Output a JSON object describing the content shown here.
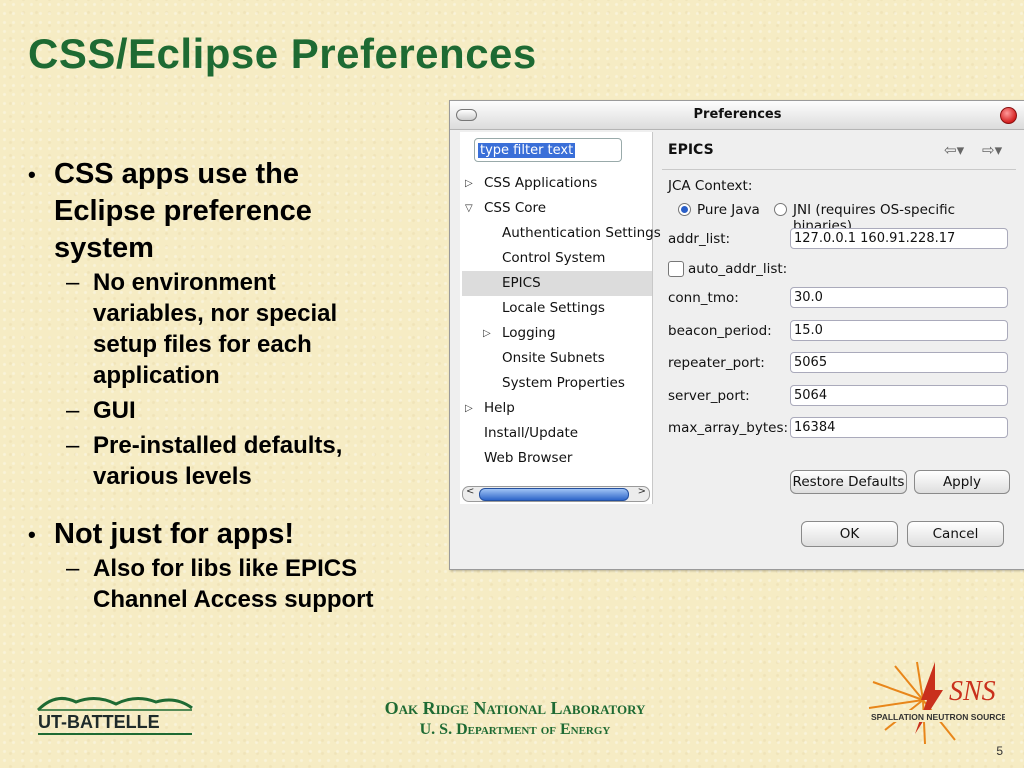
{
  "slide": {
    "title": "CSS/Eclipse Preferences",
    "bullets": [
      {
        "text_lines": [
          "CSS apps use the",
          "Eclipse preference",
          "system"
        ],
        "sub": [
          {
            "lines": [
              "No environment",
              "variables, nor special",
              "setup files for each",
              "application"
            ]
          },
          {
            "lines": [
              "GUI"
            ]
          },
          {
            "lines": [
              "Pre-installed defaults,",
              "various levels"
            ]
          }
        ]
      },
      {
        "text_lines": [
          "Not just for apps!"
        ],
        "sub": [
          {
            "lines": [
              "Also for libs like EPICS",
              "Channel Access support"
            ]
          }
        ]
      }
    ],
    "page_number": "5"
  },
  "footer": {
    "line1": "Oak Ridge National Laboratory",
    "line2": "U. S. Department of Energy",
    "left_logo_text": "UT-BATTELLE",
    "right_logo_text": "SNS",
    "right_logo_subtext": "SPALLATION NEUTRON SOURCE"
  },
  "dialog": {
    "title": "Preferences",
    "filter_placeholder": "type filter text",
    "tree": [
      {
        "label": "CSS Applications",
        "level": 0,
        "arrow": "right"
      },
      {
        "label": "CSS Core",
        "level": 0,
        "arrow": "down"
      },
      {
        "label": "Authentication Settings",
        "level": 1
      },
      {
        "label": "Control System",
        "level": 1
      },
      {
        "label": "EPICS",
        "level": 1,
        "selected": true
      },
      {
        "label": "Locale Settings",
        "level": 1
      },
      {
        "label": "Logging",
        "level": 1,
        "arrow": "right"
      },
      {
        "label": "Onsite Subnets",
        "level": 1
      },
      {
        "label": "System Properties",
        "level": 1
      },
      {
        "label": "Help",
        "level": 0,
        "arrow": "right"
      },
      {
        "label": "Install/Update",
        "level": 0
      },
      {
        "label": "Web Browser",
        "level": 0
      }
    ],
    "page_title": "EPICS",
    "jca_context_label": "JCA Context:",
    "radio_pure_java": "Pure Java",
    "radio_jni": "JNI (requires OS-specific binaries)",
    "radio_selected": "pure_java",
    "addr_list_label": "addr_list:",
    "addr_list_value": "127.0.0.1 160.91.228.17",
    "auto_addr_list_label": "auto_addr_list:",
    "auto_addr_list_checked": false,
    "conn_tmo_label": "conn_tmo:",
    "conn_tmo_value": "30.0",
    "beacon_period_label": "beacon_period:",
    "beacon_period_value": "15.0",
    "repeater_port_label": "repeater_port:",
    "repeater_port_value": "5065",
    "server_port_label": "server_port:",
    "server_port_value": "5064",
    "max_array_bytes_label": "max_array_bytes:",
    "max_array_bytes_value": "16384",
    "restore_defaults_label": "Restore Defaults",
    "apply_label": "Apply",
    "ok_label": "OK",
    "cancel_label": "Cancel"
  },
  "colors": {
    "title_green": "#1e6a33",
    "background": "#f6ecc4",
    "selection_blue": "#3a6fd8"
  }
}
